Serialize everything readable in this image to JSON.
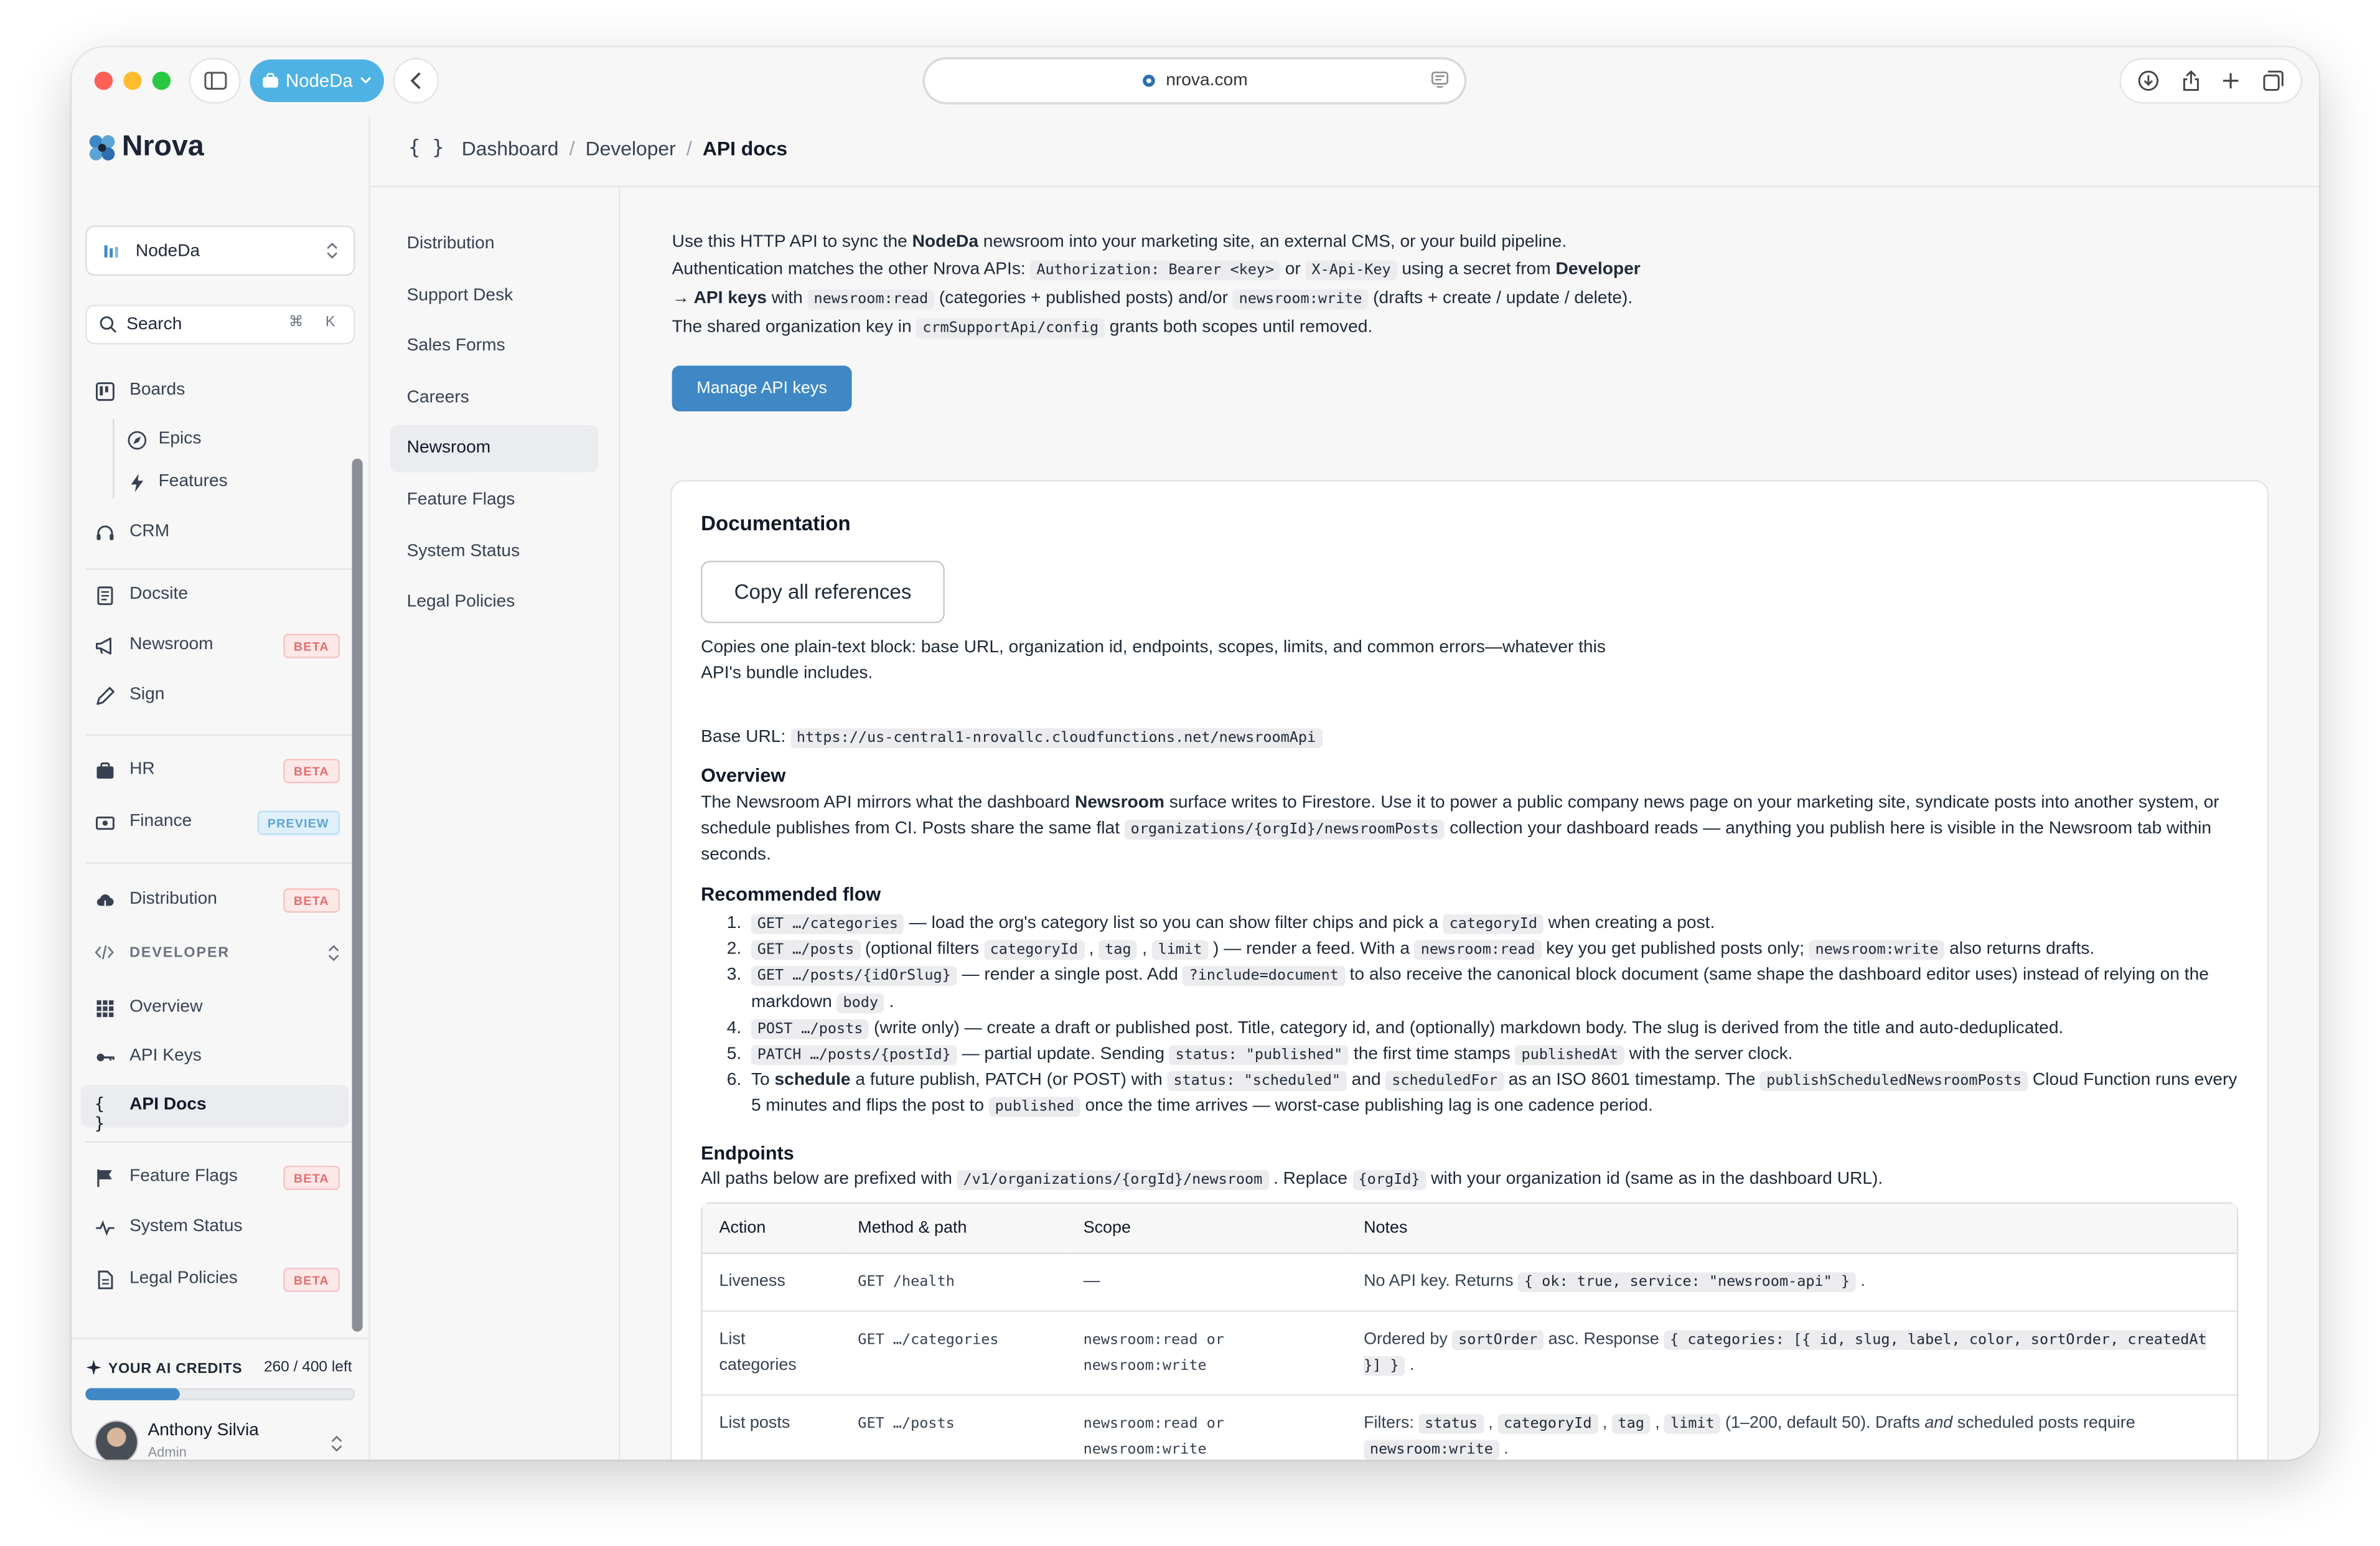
{
  "browser": {
    "profile_name": "NodeDa",
    "url": "nrova.com"
  },
  "sidebar": {
    "brand": "Nrova",
    "org_name": "NodeDa",
    "search_placeholder": "Search",
    "search_shortcut": "⌘ K",
    "items": {
      "boards": "Boards",
      "epics": "Epics",
      "features": "Features",
      "crm": "CRM",
      "docsite": "Docsite",
      "newsroom": "Newsroom",
      "sign": "Sign",
      "hr": "HR",
      "finance": "Finance",
      "distribution": "Distribution",
      "developer": "DEVELOPER",
      "overview": "Overview",
      "api_keys": "API Keys",
      "api_docs": "API Docs",
      "feature_flags": "Feature Flags",
      "system_status": "System Status",
      "legal_policies": "Legal Policies"
    },
    "badges": {
      "beta": "BETA",
      "preview": "PREVIEW"
    },
    "credits": {
      "label": "YOUR AI CREDITS",
      "count": "260 / 400 left",
      "used_fraction": 0.35
    },
    "user": {
      "name": "Anthony Silvia",
      "role": "Admin"
    }
  },
  "header": {
    "icon": "{ }",
    "crumbs": [
      "Dashboard",
      "Developer",
      "API docs"
    ]
  },
  "subnav": {
    "items": [
      "Distribution",
      "Support Desk",
      "Sales Forms",
      "Careers",
      "Newsroom",
      "Feature Flags",
      "System Status",
      "Legal Policies"
    ],
    "active": "Newsroom"
  },
  "intro": {
    "l1a": "Use this HTTP API to sync the ",
    "l1b": "NodeDa",
    "l1c": " newsroom into your marketing site, an external CMS, or your build pipeline.",
    "l2a": "Authentication matches the other Nrova APIs: ",
    "l2code1": "Authorization: Bearer <key>",
    "l2b": " or ",
    "l2code2": "X-Api-Key",
    "l2c": " using a secret from ",
    "l2d": "Developer",
    "l3a": "→ API keys",
    "l3b": " with ",
    "l3code1": "newsroom:read",
    "l3c": " (categories + published posts) and/or ",
    "l3code2": "newsroom:write",
    "l3d": " (drafts + create / update / delete).",
    "l4a": "The shared organization key in ",
    "l4code": "crmSupportApi/config",
    "l4b": " grants both scopes until removed.",
    "manage_button": "Manage API keys"
  },
  "docs": {
    "title": "Documentation",
    "copy_button": "Copy all references",
    "copy_note": "Copies one plain-text block: base URL, organization id, endpoints, scopes, limits, and common errors—whatever this API's bundle includes.",
    "base_url_label": "Base URL:",
    "base_url": "https://us-central1-nrovallc.cloudfunctions.net/newsroomApi",
    "overview_title": "Overview",
    "ov_a": "The Newsroom API mirrors what the dashboard ",
    "ov_b": "Newsroom",
    "ov_c": " surface writes to Firestore. Use it to power a public company news page on your marketing site, syndicate posts into another system, or schedule publishes from CI. Posts share the same flat ",
    "ov_code": "organizations/{orgId}/newsroomPosts",
    "ov_d": " collection your dashboard reads — anything you publish here is visible in the Newsroom tab within seconds.",
    "flow_title": "Recommended flow",
    "flow": {
      "n": [
        "1.",
        "2.",
        "3.",
        "4.",
        "5.",
        "6."
      ],
      "s1_code1": "GET …/categories",
      "s1_a": " — load the org's category list so you can show filter chips and pick a ",
      "s1_code2": "categoryId",
      "s1_b": " when creating a post.",
      "s2_code1": "GET …/posts",
      "s2_a": " (optional filters ",
      "s2_code2": "categoryId",
      "s2_b": " , ",
      "s2_code3": "tag",
      "s2_c": " , ",
      "s2_code4": "limit",
      "s2_d": " ) — render a feed. With a ",
      "s2_code5": "newsroom:read",
      "s2_e": " key you get published posts only; ",
      "s2_code6": "newsroom:write",
      "s2_f": " also returns drafts.",
      "s3_code1": "GET …/posts/{idOrSlug}",
      "s3_a": " — render a single post. Add ",
      "s3_code2": "?include=document",
      "s3_b": " to also receive the canonical block document (same shape the dashboard editor uses) instead of relying on the markdown ",
      "s3_code3": "body",
      "s3_c": " .",
      "s4_code1": "POST …/posts",
      "s4_a": " (write only) — create a draft or published post. Title, category id, and (optionally) markdown body. The slug is derived from the title and auto-deduplicated.",
      "s5_code1": "PATCH …/posts/{postId}",
      "s5_a": " — partial update. Sending ",
      "s5_code2": "status: \"published\"",
      "s5_b": " the first time stamps ",
      "s5_code3": "publishedAt",
      "s5_c": " with the server clock.",
      "s6_a": "To ",
      "s6_b": "schedule",
      "s6_c": " a future publish, PATCH (or POST) with ",
      "s6_code1": "status: \"scheduled\"",
      "s6_d": " and ",
      "s6_code2": "scheduledFor",
      "s6_e": " as an ISO 8601 timestamp. The ",
      "s6_code3": "publishScheduledNewsroomPosts",
      "s6_f": " Cloud Function runs every 5 minutes and flips the post to ",
      "s6_code4": "published",
      "s6_g": " once the time arrives — worst-case publishing lag is one cadence period."
    },
    "endpoints_title": "Endpoints",
    "ep_a": "All paths below are prefixed with ",
    "ep_code1": "/v1/organizations/{orgId}/newsroom",
    "ep_b": " . Replace ",
    "ep_code2": "{orgId}",
    "ep_c": " with your organization id (same as in the dashboard URL).",
    "table": {
      "headers": [
        "Action",
        "Method & path",
        "Scope",
        "Notes"
      ],
      "r1": {
        "action": "Liveness",
        "method": "GET /health",
        "scope": "—",
        "notes_a": "No API key. Returns ",
        "notes_code": "{ ok: true, service: \"newsroom-api\" }",
        "notes_b": " ."
      },
      "r2": {
        "action": "List categories",
        "method": "GET …/categories",
        "scope_a": "newsroom:read or",
        "scope_b": "newsroom:write",
        "notes_a": "Ordered by ",
        "notes_code1": "sortOrder",
        "notes_b": " asc. Response ",
        "notes_code2": "{ categories: [{ id, slug, label, color, sortOrder, createdAt }] }",
        "notes_c": " ."
      },
      "r3": {
        "action": "List posts",
        "method": "GET …/posts",
        "scope_a": "newsroom:read or",
        "scope_b": "newsroom:write",
        "notes_a": "Filters: ",
        "notes_code1": "status",
        "notes_s1": " , ",
        "notes_code2": "categoryId",
        "notes_s2": " , ",
        "notes_code3": "tag",
        "notes_s3": " , ",
        "notes_code4": "limit",
        "notes_b": " (1–200, default 50). Drafts ",
        "notes_em": "and",
        "notes_c": " scheduled posts require ",
        "notes_code5": "newsroom:write",
        "notes_d": " ."
      }
    }
  },
  "colors": {
    "accent": "#3f88c5",
    "profile_pill": "#4fb2e4",
    "beta_badge": "#e26d6d",
    "preview_badge": "#5aa5d6"
  }
}
